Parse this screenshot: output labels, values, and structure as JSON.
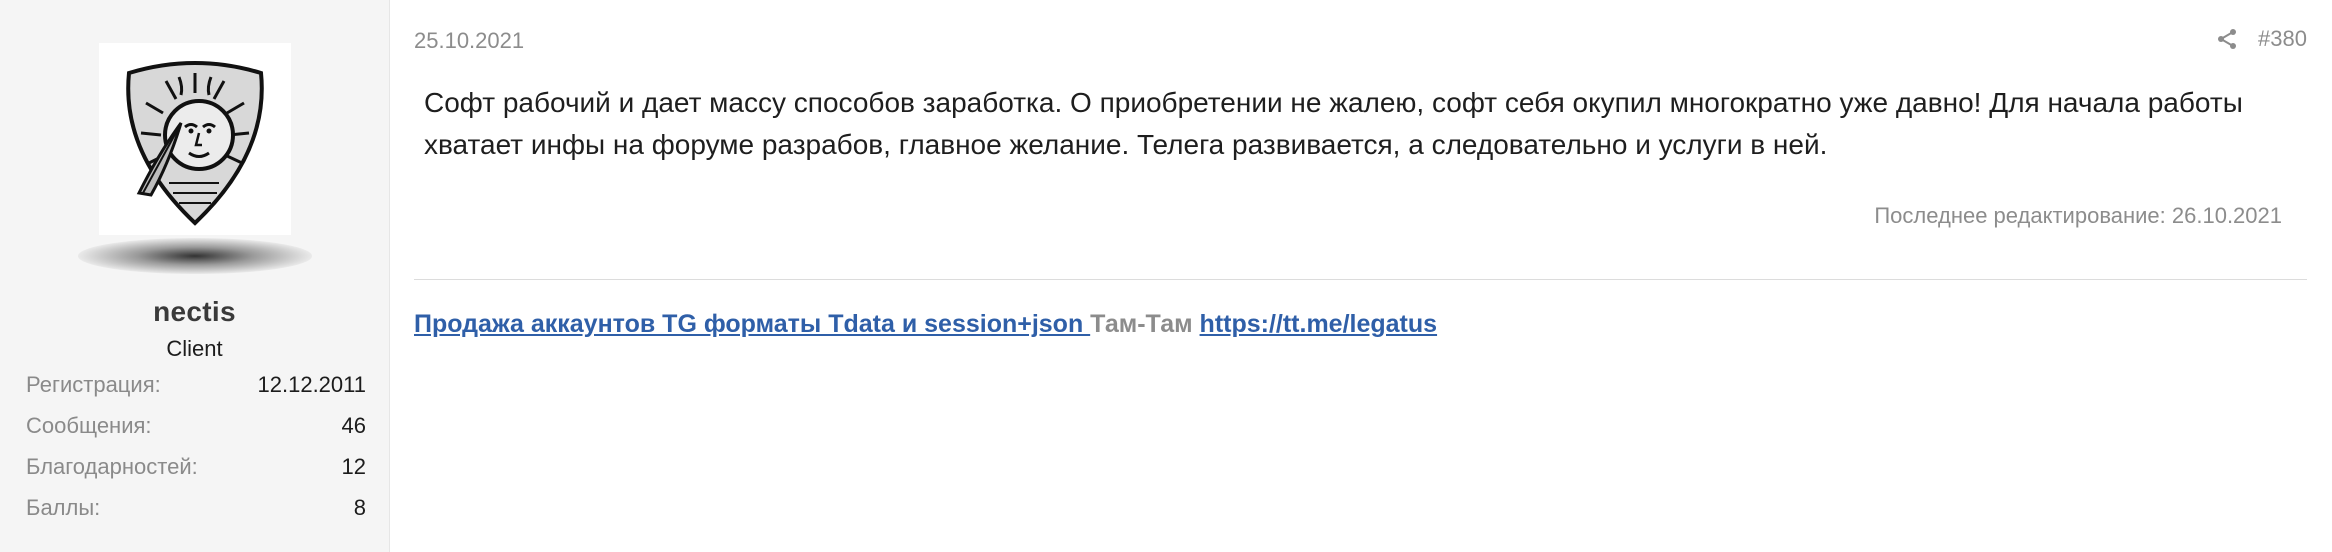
{
  "user": {
    "avatar_icon": "sun-face-shield-avatar",
    "username": "nectis",
    "title": "Client",
    "stats": [
      {
        "label": "Регистрация:",
        "value": "12.12.2011"
      },
      {
        "label": "Сообщения:",
        "value": "46"
      },
      {
        "label": "Благодарностей:",
        "value": "12"
      },
      {
        "label": "Баллы:",
        "value": "8"
      }
    ]
  },
  "post": {
    "date": "25.10.2021",
    "share_icon": "share-icon",
    "number": "#380",
    "message": "Софт рабочий и дает массу способов заработка. О приобретении не жалею, софт себя окупил многократно уже давно! Для начала работы хватает инфы на форуме разрабов, главное желание. Телега развивается, а следовательно и услуги в ней.",
    "last_edit": "Последнее редактирование: 26.10.2021"
  },
  "signature": {
    "link1_text": "Продажа аккаунтов TG форматы Tdata и session+json ",
    "middle_text": "Там-Там",
    "link2_text": "https://tt.me/legatus"
  },
  "colors": {
    "sidebar_bg": "#f5f5f5",
    "link": "#2f5fa8",
    "muted": "#8c8c8c"
  }
}
